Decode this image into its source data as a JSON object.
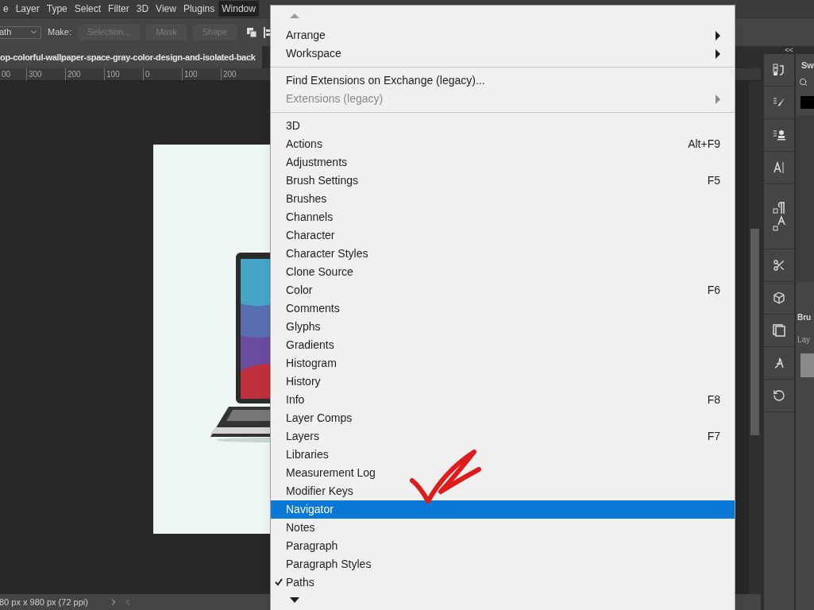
{
  "menu_bar": [
    {
      "label": "e",
      "selected": false
    },
    {
      "label": "Layer",
      "selected": false
    },
    {
      "label": "Type",
      "selected": false
    },
    {
      "label": "Select",
      "selected": false
    },
    {
      "label": "Filter",
      "selected": false
    },
    {
      "label": "3D",
      "selected": false
    },
    {
      "label": "View",
      "selected": false
    },
    {
      "label": "Plugins",
      "selected": false
    },
    {
      "label": "Window",
      "selected": true
    }
  ],
  "options_bar": {
    "mode_value": "ath",
    "make_label": "Make:",
    "buttons": [
      {
        "label": "Selection...",
        "disabled": true
      },
      {
        "label": "Mask",
        "disabled": true
      },
      {
        "label": "Shape",
        "disabled": true
      }
    ]
  },
  "document_tab": {
    "title": "op-colorful-wallpaper-space-gray-color-design-and-isolated-back"
  },
  "ruler": {
    "labels": [
      "00",
      "300",
      "200",
      "100",
      "0",
      "100",
      "200"
    ]
  },
  "status_bar": {
    "info": "80 px x 980 px (72 ppi)"
  },
  "side_panels": {
    "collapse_label": "<<",
    "tabs": [
      {
        "label": "Sw"
      },
      {
        "label": "Bru"
      },
      {
        "label": "Lay"
      }
    ]
  },
  "window_menu": {
    "sections": [
      [
        {
          "kind": "submenu",
          "label": "Arrange",
          "disabled": false
        },
        {
          "kind": "submenu",
          "label": "Workspace",
          "disabled": false
        }
      ],
      [
        {
          "kind": "item",
          "label": "Find Extensions on Exchange (legacy)...",
          "disabled": false
        },
        {
          "kind": "submenu",
          "label": "Extensions (legacy)",
          "disabled": true
        }
      ],
      [
        {
          "kind": "item",
          "label": "3D",
          "checked": false,
          "selected": false
        },
        {
          "kind": "item",
          "label": "Actions",
          "shortcut": "Alt+F9",
          "checked": false,
          "selected": false
        },
        {
          "kind": "item",
          "label": "Adjustments",
          "checked": false,
          "selected": false
        },
        {
          "kind": "item",
          "label": "Brush Settings",
          "shortcut": "F5",
          "checked": false,
          "selected": false
        },
        {
          "kind": "item",
          "label": "Brushes",
          "checked": false,
          "selected": false
        },
        {
          "kind": "item",
          "label": "Channels",
          "checked": false,
          "selected": false
        },
        {
          "kind": "item",
          "label": "Character",
          "checked": false,
          "selected": false
        },
        {
          "kind": "item",
          "label": "Character Styles",
          "checked": false,
          "selected": false
        },
        {
          "kind": "item",
          "label": "Clone Source",
          "checked": false,
          "selected": false
        },
        {
          "kind": "item",
          "label": "Color",
          "shortcut": "F6",
          "checked": false,
          "selected": false
        },
        {
          "kind": "item",
          "label": "Comments",
          "checked": false,
          "selected": false
        },
        {
          "kind": "item",
          "label": "Glyphs",
          "checked": false,
          "selected": false
        },
        {
          "kind": "item",
          "label": "Gradients",
          "checked": false,
          "selected": false
        },
        {
          "kind": "item",
          "label": "Histogram",
          "checked": false,
          "selected": false
        },
        {
          "kind": "item",
          "label": "History",
          "checked": false,
          "selected": false
        },
        {
          "kind": "item",
          "label": "Info",
          "shortcut": "F8",
          "checked": false,
          "selected": false
        },
        {
          "kind": "item",
          "label": "Layer Comps",
          "checked": false,
          "selected": false
        },
        {
          "kind": "item",
          "label": "Layers",
          "shortcut": "F7",
          "checked": false,
          "selected": false
        },
        {
          "kind": "item",
          "label": "Libraries",
          "checked": false,
          "selected": false
        },
        {
          "kind": "item",
          "label": "Measurement Log",
          "checked": false,
          "selected": false
        },
        {
          "kind": "item",
          "label": "Modifier Keys",
          "checked": false,
          "selected": false
        },
        {
          "kind": "item",
          "label": "Navigator",
          "checked": false,
          "selected": true
        },
        {
          "kind": "item",
          "label": "Notes",
          "checked": false,
          "selected": false
        },
        {
          "kind": "item",
          "label": "Paragraph",
          "checked": false,
          "selected": false
        },
        {
          "kind": "item",
          "label": "Paragraph Styles",
          "checked": false,
          "selected": false
        },
        {
          "kind": "item",
          "label": "Paths",
          "checked": true,
          "selected": false
        }
      ]
    ]
  }
}
